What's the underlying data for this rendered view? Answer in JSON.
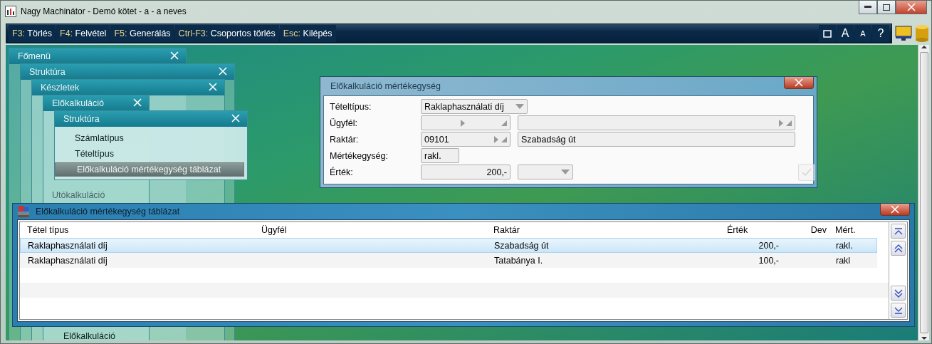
{
  "window": {
    "title": "Nagy Machinátor - Demó kötet - a - a neves"
  },
  "toolbar": {
    "commands": [
      {
        "key": "F3:",
        "label": "Törlés"
      },
      {
        "key": "F4:",
        "label": "Felvétel"
      },
      {
        "key": "F5:",
        "label": "Generálás"
      },
      {
        "key": "Ctrl-F3:",
        "label": "Csoportos törlés"
      },
      {
        "key": "Esc:",
        "label": "Kilépés"
      }
    ],
    "view_buttons": [
      {
        "kind": "frame"
      },
      {
        "kind": "text",
        "label": "A"
      },
      {
        "kind": "small",
        "label": "A"
      },
      {
        "kind": "text",
        "label": "?"
      }
    ]
  },
  "menus": [
    {
      "title": "Főmenü"
    },
    {
      "title": "Struktúra"
    },
    {
      "title": "Készletek",
      "items": [
        {
          "label": "Utókalkuláció",
          "selected": false
        }
      ]
    },
    {
      "title": "Előkalkuláció",
      "items": [
        {
          "label": "Előkalkuláció",
          "selected": false
        }
      ]
    },
    {
      "title": "Struktúra",
      "items": [
        {
          "label": "Számlatípus",
          "selected": false
        },
        {
          "label": "Tételtípus",
          "selected": false
        },
        {
          "label": "Előkalkuláció mértékegység táblázat",
          "selected": true
        }
      ]
    }
  ],
  "dialog": {
    "title": "Előkalkuláció mértékegység",
    "fields": [
      {
        "label": "Tételtípus:",
        "value": "Raklaphasználati díj"
      },
      {
        "label": "Ügyfél:"
      },
      {
        "label": "Raktár:",
        "code": "09101",
        "value": "Szabadság út"
      },
      {
        "label": "Mértékegység:",
        "value": "rakl."
      },
      {
        "label": "Érték:",
        "value": "200,-"
      }
    ],
    "ok_disabled": true
  },
  "table_window": {
    "title": "Előkalkuláció mértékegység táblázat",
    "columns": [
      "Tétel típus",
      "Ügyfél",
      "Raktár",
      "Érték",
      "Dev",
      "Mért."
    ],
    "rows": [
      {
        "cells": [
          "Raklaphasználati díj",
          "",
          "Szabadság út",
          "200,-",
          "",
          "rakl."
        ],
        "selected": true
      },
      {
        "cells": [
          "Raklaphasználati díj",
          "",
          "Tatabánya I.",
          "100,-",
          "",
          "rakl"
        ],
        "selected": false
      }
    ]
  }
}
